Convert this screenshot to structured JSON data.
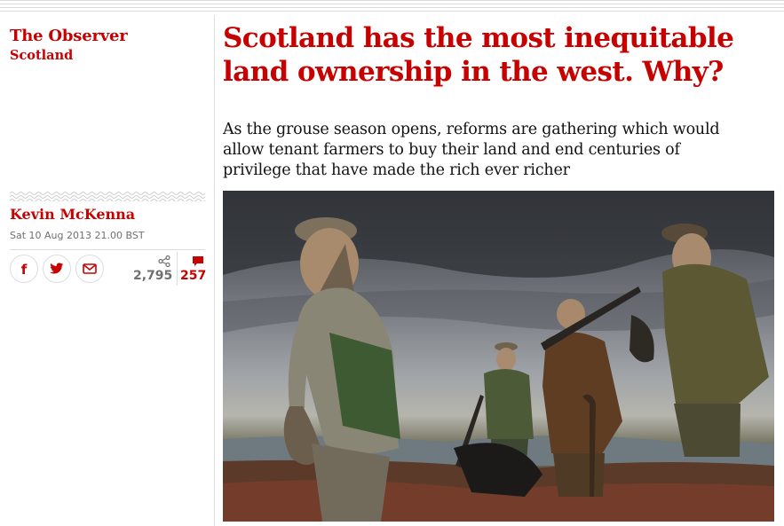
{
  "section": {
    "title": "The Observer",
    "subtitle": "Scotland"
  },
  "article": {
    "headline": "Scotland has the most inequitable land ownership in the west. Why?",
    "standfirst": "As the grouse season opens, reforms are gathering which would allow tenant farmers to buy their land and end centuries of privilege that have made the rich ever richer",
    "byline": "Kevin McKenna",
    "date": "Sat 10 Aug 2013 21.00 BST"
  },
  "share": {
    "count": "2,795",
    "buttons": [
      "facebook-icon",
      "twitter-icon",
      "email-icon"
    ]
  },
  "comments": {
    "count": "257"
  },
  "colors": {
    "accent": "#c70000",
    "muted": "#707070",
    "rule": "#dcdcdc"
  }
}
